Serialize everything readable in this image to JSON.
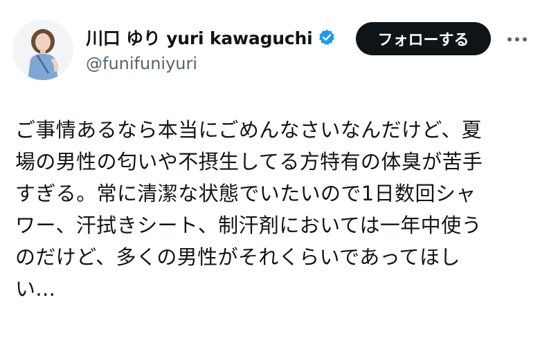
{
  "author": {
    "display_name": "川口 ゆり yuri kawaguchi",
    "handle": "@funifuniyuri",
    "verified": true
  },
  "actions": {
    "follow_label": "フォローする",
    "more_icon": "more-horizontal-icon"
  },
  "tweet": {
    "lines": [
      "ご事情あるなら本当にごめんなさいなんだけど、夏",
      "場の男性の匂いや不摂生してる方特有の体臭が苦手",
      "すぎる。常に清潔な状態でいたいので1日数回シャ",
      "ワー、汗拭きシート、制汗剤においては一年中使う",
      "のだけど、多くの男性がそれくらいであってほし",
      "い..."
    ]
  },
  "colors": {
    "text_primary": "#0f1419",
    "text_secondary": "#536471",
    "follow_bg": "#0f1419",
    "verified_blue": "#1d9bf0"
  }
}
